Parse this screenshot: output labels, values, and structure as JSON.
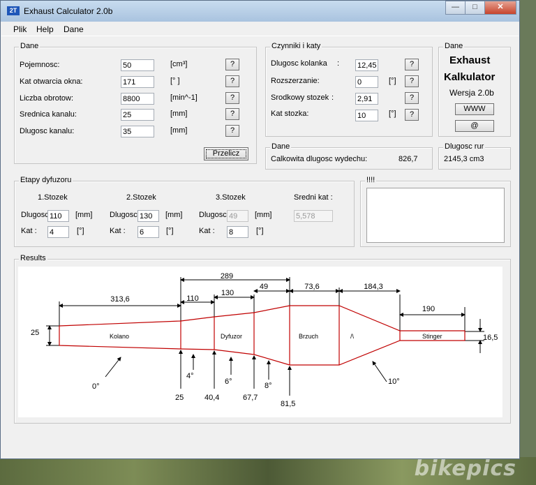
{
  "window": {
    "title": "Exhaust Calculator 2.0b",
    "icon_text": "2T"
  },
  "menu": [
    "Plik",
    "Help",
    "Dane"
  ],
  "dane": {
    "label": "Dane",
    "rows": [
      {
        "label": "Pojemnosc:",
        "value": "50",
        "unit": "[cm³]"
      },
      {
        "label": "Kat otwarcia okna:",
        "value": "171",
        "unit": "[° ]"
      },
      {
        "label": "Liczba obrotow:",
        "value": "8800",
        "unit": "[min^-1]"
      },
      {
        "label": "Srednica kanalu:",
        "value": "25",
        "unit": "[mm]"
      },
      {
        "label": "Dlugosc kanalu:",
        "value": "35",
        "unit": "[mm]"
      }
    ],
    "help_label": "?",
    "calc_button": "Przelicz"
  },
  "czynniki": {
    "label": "Czynniki i katy",
    "rows": [
      {
        "label": "Dlugosc kolanka",
        "sep": ":",
        "value": "12,45",
        "unit": ""
      },
      {
        "label": "Rozszerzanie:",
        "sep": "",
        "value": "0",
        "unit": "[°]"
      },
      {
        "label": "Srodkowy stozek",
        "sep": ":",
        "value": "2,91",
        "unit": ""
      },
      {
        "label": "Kat stozka:",
        "sep": "",
        "value": "10",
        "unit": "[°]"
      }
    ],
    "help_label": "?"
  },
  "about": {
    "label": "Dane",
    "line1": "Exhaust",
    "line2": "Kalkulator",
    "version": "Wersja  2.0b",
    "www_button": "WWW",
    "mail_button": "@"
  },
  "summary": {
    "label": "Dane",
    "text": "Calkowita dlugosc wydechu:",
    "value": "826,7"
  },
  "pipe": {
    "label": "Dlugosc rur",
    "value": "2145,3 cm3"
  },
  "etapy": {
    "label": "Etapy dyfuzoru",
    "stages": [
      {
        "title": "1.Stozek",
        "len_label": "Dlugosc",
        "len": "110",
        "len_unit": "[mm]",
        "ang_label": "Kat  :",
        "ang": "4",
        "ang_unit": "[°]",
        "disabled": false
      },
      {
        "title": "2.Stozek",
        "len_label": "Dlugosc",
        "len": "130",
        "len_unit": "[mm]",
        "ang_label": "Kat  :",
        "ang": "6",
        "ang_unit": "[°]",
        "disabled": false
      },
      {
        "title": "3.Stozek",
        "len_label": "Dlugosc",
        "len": "49",
        "len_unit": "[mm]",
        "ang_label": "Kat  :",
        "ang": "8",
        "ang_unit": "[°]",
        "disabled": true
      }
    ],
    "avg_label": "Sredni kat  :",
    "avg_value": "5,578"
  },
  "notes": {
    "label": "!!!!"
  },
  "results": {
    "label": "Results",
    "dims_top": [
      "313,6",
      "110",
      "130",
      "49",
      "73,6",
      "184,3",
      "190"
    ],
    "dim_total": "289",
    "left_dia": "25",
    "right_dia": "16,5",
    "sections": [
      "Kolano",
      "Dyfuzor",
      "Brzuch",
      "/\\",
      "Stinger"
    ],
    "bottom_dias": [
      "25",
      "40,4",
      "67,7",
      "81,5"
    ],
    "angles": [
      "0°",
      "4°",
      "6°",
      "8°",
      "10°"
    ],
    "outline_color": "#c00000"
  },
  "watermark": "bikepics"
}
